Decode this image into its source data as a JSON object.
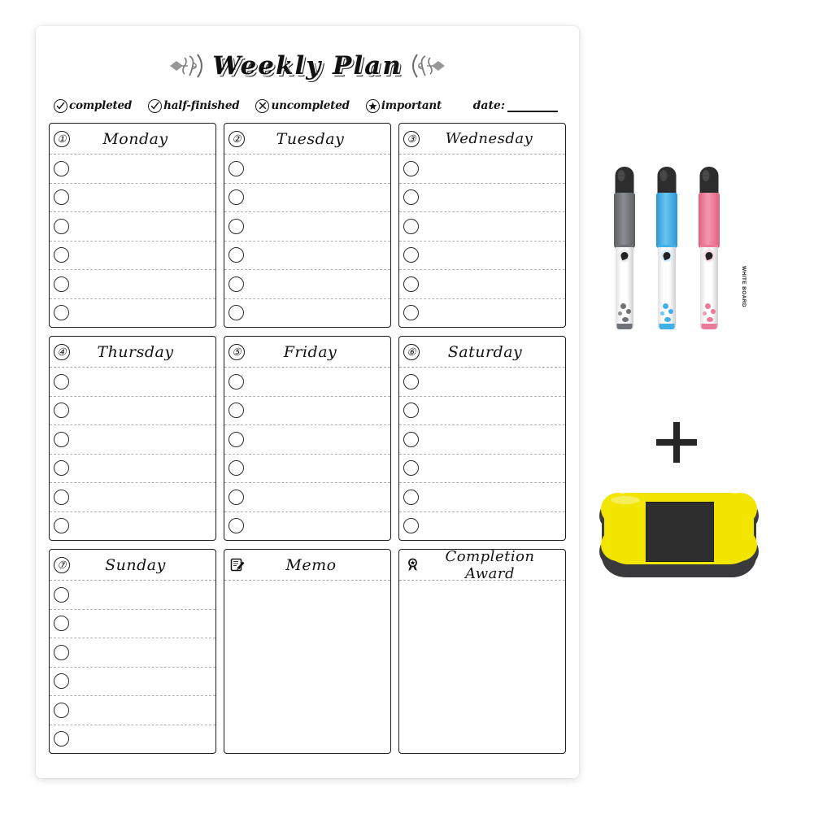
{
  "product": {
    "title": "Weekly Plan",
    "date_label": "date:"
  },
  "legend": {
    "items": [
      {
        "icon": "circled-check-icon",
        "label": "completed"
      },
      {
        "icon": "circled-check-icon",
        "label": "half-finished"
      },
      {
        "icon": "circled-x-icon",
        "label": "uncompleted"
      },
      {
        "icon": "circled-star-icon",
        "label": "important"
      }
    ]
  },
  "grid": {
    "cells": [
      {
        "number": "①",
        "name": "Monday",
        "type": "day",
        "rows": 6
      },
      {
        "number": "②",
        "name": "Tuesday",
        "type": "day",
        "rows": 6
      },
      {
        "number": "③",
        "name": "Wednesday",
        "type": "day",
        "rows": 6
      },
      {
        "number": "④",
        "name": "Thursday",
        "type": "day",
        "rows": 6
      },
      {
        "number": "⑤",
        "name": "Friday",
        "type": "day",
        "rows": 6
      },
      {
        "number": "⑥",
        "name": "Saturday",
        "type": "day",
        "rows": 6
      },
      {
        "number": "⑦",
        "name": "Sunday",
        "type": "day",
        "rows": 6
      },
      {
        "icon": "memo-notepad-pen-icon",
        "name": "Memo",
        "type": "note",
        "rows": 0
      },
      {
        "icon": "award-ribbon-icon",
        "name": "Completion Award",
        "type": "note",
        "rows": 0
      }
    ]
  },
  "accessories": {
    "plus_symbol": "+",
    "markers": [
      {
        "name": "gray-marker",
        "barrel_color": "#6f7277",
        "tip_color": "#2d2d2d",
        "label": "WHITE BOARD"
      },
      {
        "name": "blue-marker",
        "barrel_color": "#3fb0e8",
        "tip_color": "#1f1f1f",
        "label": "WHITE BOARD"
      },
      {
        "name": "pink-marker",
        "barrel_color": "#ee7a99",
        "tip_color": "#1f1f1f",
        "label": "WHITE BOARD"
      }
    ],
    "eraser": {
      "name": "magnetic-board-eraser",
      "body_color": "#f2e500",
      "pad_color": "#2e2e2e",
      "base_color": "#3a3a3c"
    }
  }
}
